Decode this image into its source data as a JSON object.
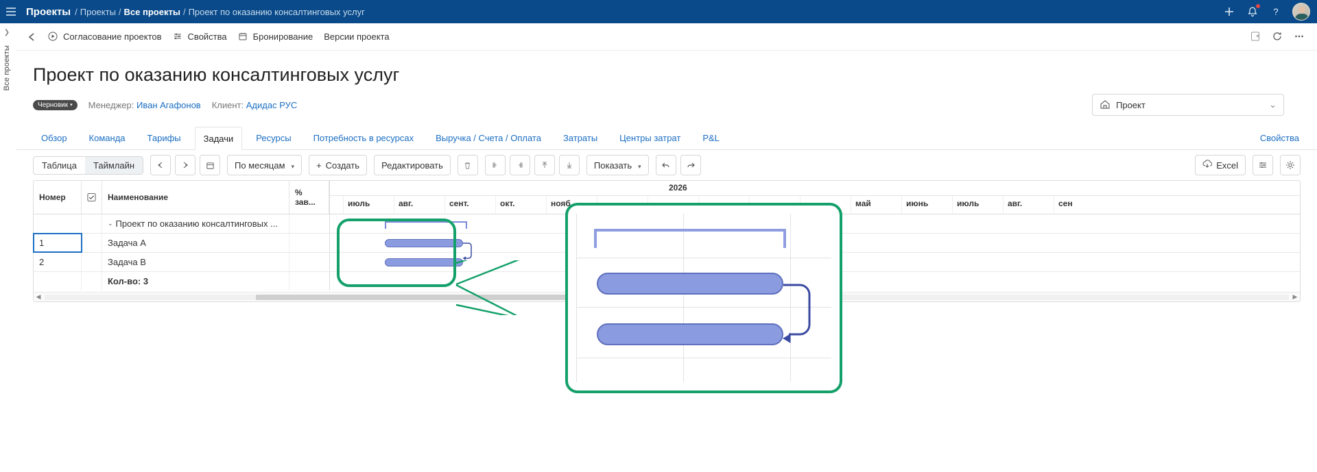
{
  "topbar": {
    "section": "Проекты",
    "breadcrumb": [
      {
        "label": "Проекты",
        "active": false
      },
      {
        "label": "Все проекты",
        "active": true
      },
      {
        "label": "Проект по оказанию консалтинговых услуг",
        "active": false
      }
    ]
  },
  "sidebar_tab": "Все проекты",
  "toolbar2": {
    "approval": "Согласование проектов",
    "properties": "Свойства",
    "booking": "Бронирование",
    "versions": "Версии проекта"
  },
  "page": {
    "title": "Проект по оказанию консалтинговых услуг",
    "status_badge": "Черновик",
    "manager_label": "Менеджер:",
    "manager_name": "Иван Агафонов",
    "client_label": "Клиент:",
    "client_name": "Адидас РУС",
    "project_selector_label": "Проект"
  },
  "tabs": {
    "items": [
      "Обзор",
      "Команда",
      "Тарифы",
      "Задачи",
      "Ресурсы",
      "Потребность в ресурсах",
      "Выручка / Счета / Оплата",
      "Затраты",
      "Центры затрат",
      "P&L"
    ],
    "active_index": 3,
    "right_link": "Свойства"
  },
  "tb3": {
    "view_table": "Таблица",
    "view_timeline": "Таймлайн",
    "scale_label": "По месяцам",
    "create": "Создать",
    "edit": "Редактировать",
    "show": "Показать",
    "excel": "Excel"
  },
  "gantt": {
    "columns": {
      "number": "Номер",
      "name": "Наименование",
      "pct": "% зав..."
    },
    "year_label": "2026",
    "months": [
      "",
      "июль",
      "авг.",
      "сент.",
      "окт.",
      "нояб.",
      "",
      "",
      "",
      "",
      "",
      "май",
      "июнь",
      "июль",
      "авг.",
      "сен"
    ],
    "rows": [
      {
        "num": "",
        "name": "Проект по оказанию консалтинговых ...",
        "indent": 1,
        "is_summary": true
      },
      {
        "num": "1",
        "name": "Задача A",
        "indent": 2,
        "selected": true
      },
      {
        "num": "2",
        "name": "Задача B",
        "indent": 2
      }
    ],
    "footer_count": "Кол-во: 3"
  }
}
